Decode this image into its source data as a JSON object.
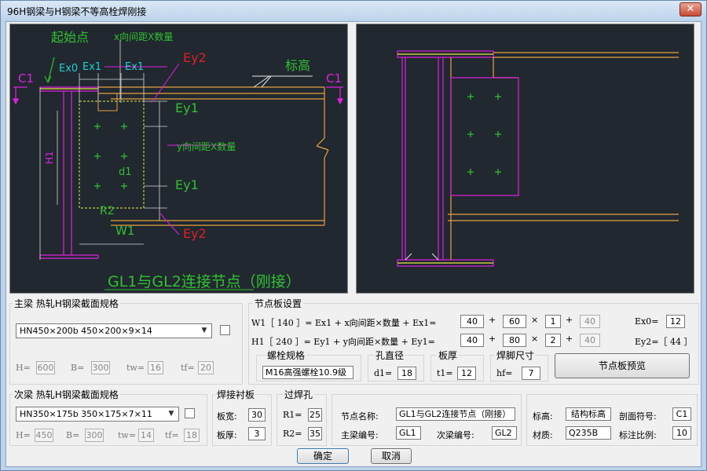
{
  "window": {
    "title": "96H钢梁与H钢梁不等高栓焊刚接",
    "close_glyph": "✕"
  },
  "left_drawing": {
    "labels": {
      "start_point": "起始点",
      "x_spacing": "x向间距X数量",
      "ex0": "Ex0",
      "ex1a": "Ex1",
      "ex1b": "Ex1",
      "ey2_top": "Ey2",
      "elevation": "标高",
      "c1_left": "C1",
      "c1_right": "C1",
      "ey1_a": "Ey1",
      "y_spacing": "y向间距X数量",
      "h1": "H1",
      "d1": "d1",
      "ey1_b": "Ey1",
      "r2": "R2",
      "w1": "W1",
      "ey2_bottom": "Ey2",
      "caption": "GL1与GL2连接节点（刚接）"
    }
  },
  "main_beam": {
    "group_label": "主梁   热轧H钢梁截面规格",
    "combo_value": "HN450×200b    450×200×9×14",
    "fields": [
      {
        "label": "H=",
        "value": "600"
      },
      {
        "label": "B=",
        "value": "300"
      },
      {
        "label": "tw=",
        "value": "16"
      },
      {
        "label": "tf=",
        "value": "20"
      }
    ]
  },
  "node_plate": {
    "group_label": "节点板设置",
    "w1_formula": "W1［  140  ］= Ex1 + x向间距×数量 + Ex1=",
    "h1_formula": "H1［  240  ］= Ey1 + y向间距×数量 + Ey1=",
    "row1": {
      "a": "40",
      "b": "60",
      "c": "1",
      "d": "40",
      "plus1": "+",
      "times": "×",
      "plus2": "+"
    },
    "row2": {
      "a": "40",
      "b": "80",
      "c": "2",
      "d": "40",
      "plus1": "+",
      "times": "×",
      "plus2": "+"
    },
    "ex0_label": "Ex0=",
    "ex0_value": "12",
    "ey2_text": "Ey2=［   44    ］",
    "bolt_label": "螺栓规格",
    "bolt_value": "M16高强螺栓10.9级",
    "hole_label": "孔直径",
    "d1_label": "d1=",
    "d1_value": "18",
    "thick_label": "板厚",
    "t1_label": "t1=",
    "t1_value": "12",
    "weld_label": "焊脚尺寸",
    "hf_label": "hf=",
    "hf_value": "7",
    "preview_button": "节点板预览"
  },
  "secondary_beam": {
    "group_label": "次梁   热轧H钢梁截面规格",
    "combo_value": "HN350×175b    350×175×7×11",
    "fields": [
      {
        "label": "H=",
        "value": "450"
      },
      {
        "label": "B=",
        "value": "300"
      },
      {
        "label": "tw=",
        "value": "14"
      },
      {
        "label": "tf=",
        "value": "18"
      }
    ]
  },
  "weld_backing": {
    "group_label": "焊接衬板",
    "width_label": "板宽:",
    "width_value": "30",
    "thick_label": "板厚:",
    "thick_value": "3"
  },
  "weld_hole": {
    "group_label": "过焊孔",
    "r1_label": "R1=",
    "r1_value": "25",
    "r2_label": "R2=",
    "r2_value": "35"
  },
  "node_info": {
    "name_label": "节点名称:",
    "name_value": "GL1与GL2连接节点（刚接）",
    "main_no_label": "主梁编号:",
    "main_no_value": "GL1",
    "sec_no_label": "次梁编号:",
    "sec_no_value": "GL2"
  },
  "annotation": {
    "elev_label": "标高:",
    "elev_value": "结构标高",
    "section_label": "剖面符号:",
    "section_value": "C1",
    "material_label": "材质:",
    "material_value": "Q235B",
    "scale_label": "标注比例:",
    "scale_value": "10"
  },
  "buttons": {
    "ok": "确定",
    "cancel": "取消"
  },
  "colors": {
    "cad_bg": "#212830",
    "magenta": "#e020e0",
    "orange": "#e8a040",
    "green": "#30c030",
    "red": "#e02020",
    "cyan": "#20d0d0",
    "yellow": "#e8e840",
    "white": "#e8e8e8"
  }
}
